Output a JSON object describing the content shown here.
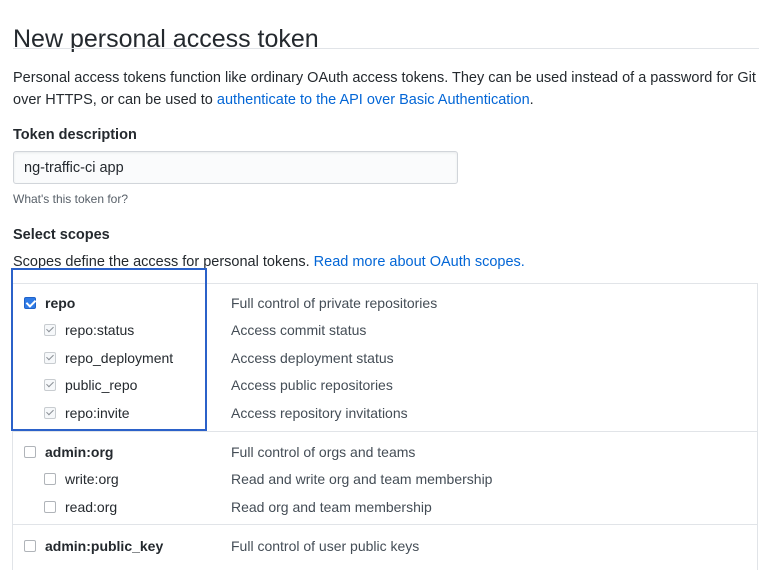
{
  "page": {
    "title": "New personal access token"
  },
  "intro": {
    "text_before": "Personal access tokens function like ordinary OAuth access tokens. They can be used instead of a password for Git over HTTPS, or can be used to ",
    "link": "authenticate to the API over Basic Authentication",
    "text_after": "."
  },
  "description": {
    "label": "Token description",
    "value": "ng-traffic-ci app",
    "hint": "What's this token for?"
  },
  "scopes": {
    "heading": "Select scopes",
    "note": "Scopes define the access for personal tokens. ",
    "note_link": "Read more about OAuth scopes.",
    "groups": [
      {
        "name": "repo",
        "desc": "Full control of private repositories",
        "checked": true,
        "children": [
          {
            "name": "repo:status",
            "desc": "Access commit status",
            "checked": true
          },
          {
            "name": "repo_deployment",
            "desc": "Access deployment status",
            "checked": true
          },
          {
            "name": "public_repo",
            "desc": "Access public repositories",
            "checked": true
          },
          {
            "name": "repo:invite",
            "desc": "Access repository invitations",
            "checked": true
          }
        ]
      },
      {
        "name": "admin:org",
        "desc": "Full control of orgs and teams",
        "checked": false,
        "children": [
          {
            "name": "write:org",
            "desc": "Read and write org and team membership",
            "checked": false
          },
          {
            "name": "read:org",
            "desc": "Read org and team membership",
            "checked": false
          }
        ]
      },
      {
        "name": "admin:public_key",
        "desc": "Full control of user public keys",
        "checked": false,
        "children": []
      }
    ]
  },
  "colors": {
    "link": "#0366d6",
    "checkbox_checked": "#2f7be6",
    "highlight_box": "#2b61c9"
  }
}
